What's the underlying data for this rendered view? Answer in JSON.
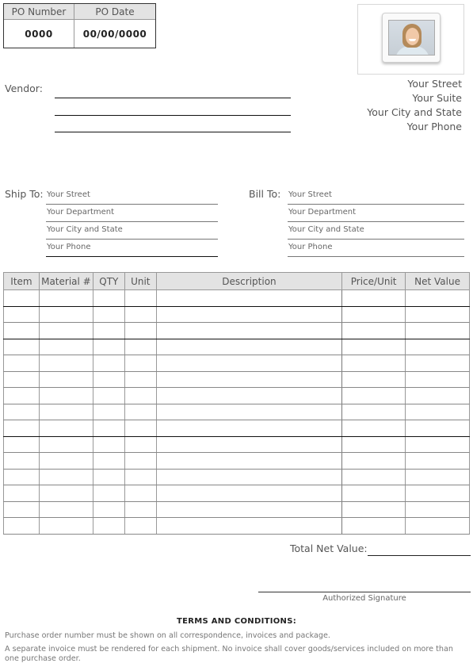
{
  "po": {
    "number_label": "PO Number",
    "date_label": "PO Date",
    "number_value": "0000",
    "date_value": "00/00/0000"
  },
  "company": {
    "photo_icon": "person-photo",
    "address": [
      "Your Street",
      "Your Suite",
      "Your City and State",
      "Your Phone"
    ]
  },
  "vendor": {
    "label": "Vendor:"
  },
  "ship_to": {
    "label": "Ship To:",
    "fields": [
      "Your Street",
      "Your Department",
      "Your City and State",
      "Your Phone"
    ]
  },
  "bill_to": {
    "label": "Bill To:",
    "fields": [
      "Your Street",
      "Your Department",
      "Your City and State",
      "Your Phone"
    ]
  },
  "items_table": {
    "columns": [
      "Item",
      "Material #",
      "QTY",
      "Unit",
      "Description",
      "Price/Unit",
      "Net Value"
    ],
    "row_count": 15
  },
  "totals": {
    "total_label": "Total Net Value:",
    "signature_label": "Authorized Signature"
  },
  "terms": {
    "title": "TERMS AND CONDITIONS:",
    "paragraphs": [
      "Purchase order number must be shown on all correspondence, invoices and package.",
      "A separate invoice must be rendered for each shipment. No invoice shall cover goods/services included on more than one purchase order."
    ]
  }
}
